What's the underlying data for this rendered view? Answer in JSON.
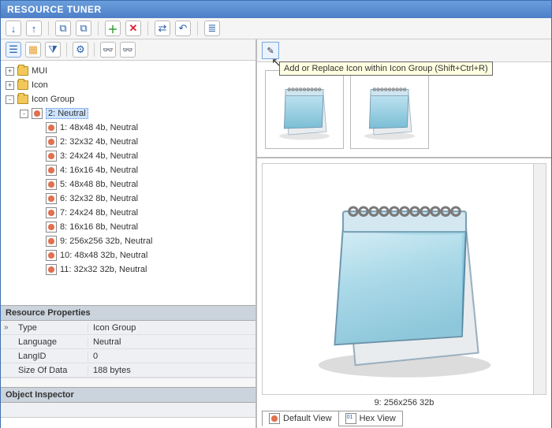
{
  "app": {
    "title": "RESOURCE TUNER"
  },
  "toolbar": {
    "download": "↓",
    "upload": "↑",
    "copy": "⧉",
    "copy2": "⧉",
    "add": "＋",
    "remove": "✕",
    "transform": "⇄",
    "undo": "↶",
    "list": "≣"
  },
  "leftTools": {
    "tree": "☰",
    "image": "▦",
    "filter": "⧩",
    "slider": "⚙",
    "find": "👓",
    "find2": "👓"
  },
  "tree": {
    "nodes": [
      {
        "depth": 0,
        "exp": "+",
        "type": "folder",
        "label": "MUI"
      },
      {
        "depth": 0,
        "exp": "+",
        "type": "folder",
        "label": "Icon"
      },
      {
        "depth": 0,
        "exp": "-",
        "type": "folder",
        "label": "Icon Group"
      },
      {
        "depth": 1,
        "exp": "-",
        "type": "leaf",
        "label": "2: Neutral",
        "selected": true
      },
      {
        "depth": 2,
        "exp": "",
        "type": "leaf",
        "label": "1: 48x48 4b, Neutral"
      },
      {
        "depth": 2,
        "exp": "",
        "type": "leaf",
        "label": "2: 32x32 4b, Neutral"
      },
      {
        "depth": 2,
        "exp": "",
        "type": "leaf",
        "label": "3: 24x24 4b, Neutral"
      },
      {
        "depth": 2,
        "exp": "",
        "type": "leaf",
        "label": "4: 16x16 4b, Neutral"
      },
      {
        "depth": 2,
        "exp": "",
        "type": "leaf",
        "label": "5: 48x48 8b, Neutral"
      },
      {
        "depth": 2,
        "exp": "",
        "type": "leaf",
        "label": "6: 32x32 8b, Neutral"
      },
      {
        "depth": 2,
        "exp": "",
        "type": "leaf",
        "label": "7: 24x24 8b, Neutral"
      },
      {
        "depth": 2,
        "exp": "",
        "type": "leaf",
        "label": "8: 16x16 8b, Neutral"
      },
      {
        "depth": 2,
        "exp": "",
        "type": "leaf",
        "label": "9: 256x256 32b, Neutral"
      },
      {
        "depth": 2,
        "exp": "",
        "type": "leaf",
        "label": "10: 48x48 32b, Neutral"
      },
      {
        "depth": 2,
        "exp": "",
        "type": "leaf",
        "label": "11: 32x32 32b, Neutral"
      }
    ]
  },
  "resourceProps": {
    "header": "Resource Properties",
    "rows": [
      {
        "k": "Type",
        "v": "Icon Group"
      },
      {
        "k": "Language",
        "v": "Neutral"
      },
      {
        "k": "LangID",
        "v": "0"
      },
      {
        "k": "Size Of Data",
        "v": "188 bytes"
      }
    ]
  },
  "objectInspector": {
    "header": "Object Inspector"
  },
  "rightTool": {
    "tooltip": "Add or Replace Icon within Icon Group (Shift+Ctrl+R)",
    "icon": "✎"
  },
  "preview": {
    "caption": "9: 256x256 32b"
  },
  "viewTabs": {
    "default": "Default View",
    "hex": "Hex View"
  }
}
